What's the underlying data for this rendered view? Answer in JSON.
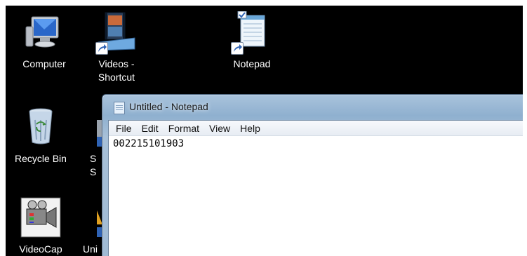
{
  "desktop": {
    "icons": [
      {
        "id": "computer",
        "label": "Computer"
      },
      {
        "id": "videos",
        "label": "Videos -\nShortcut"
      },
      {
        "id": "notepad",
        "label": "Notepad"
      },
      {
        "id": "recycle",
        "label": "Recycle Bin"
      },
      {
        "id": "hidden1",
        "label": "S\nS"
      },
      {
        "id": "videocap",
        "label": "VideoCap"
      },
      {
        "id": "hidden2",
        "label": "Uni"
      }
    ]
  },
  "window": {
    "title": "Untitled - Notepad",
    "menu": [
      "File",
      "Edit",
      "Format",
      "View",
      "Help"
    ],
    "content": "002215101903"
  },
  "colors": {
    "desktop_bg": "#000000",
    "titlebar": "#a9c3dc",
    "text": "#ffffff"
  }
}
